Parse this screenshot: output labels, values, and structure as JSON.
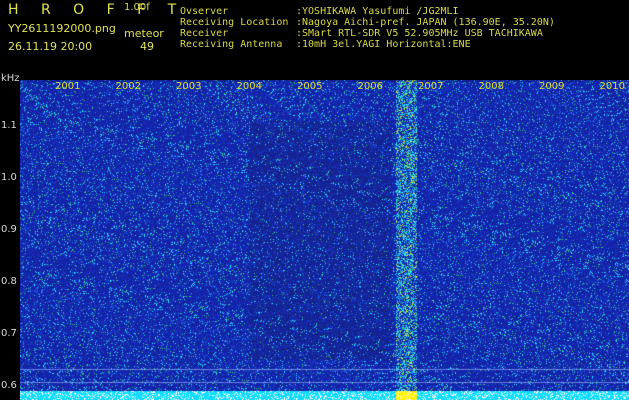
{
  "header": {
    "brand": "H R O F F T",
    "version": "1.00f",
    "filename": "YY2611192000.png",
    "datetime": "26.11.19 20:00",
    "meteor_label": "meteor",
    "meteor_count": "49"
  },
  "info": [
    {
      "key": "Ovserver",
      "value": ":YOSHIKAWA Yasufumi /JG2MLI"
    },
    {
      "key": "Receiving Location",
      "value": ":Nagoya Aichi-pref. JAPAN (136.90E, 35.20N)"
    },
    {
      "key": "Receiver",
      "value": ":SMart RTL-SDR V5 52.905MHz USB TACHIKAWA"
    },
    {
      "key": "Receiving Antenna",
      "value": ":10mH 3el.YAGI Horizontal:ENE"
    }
  ],
  "axis": {
    "unit": "kHz",
    "freq_labels": [
      {
        "text": "1.1",
        "value": 1.1
      },
      {
        "text": "1.0",
        "value": 1.0
      },
      {
        "text": "0.9",
        "value": 0.9
      },
      {
        "text": "0.8",
        "value": 0.8
      },
      {
        "text": "0.7",
        "value": 0.7
      },
      {
        "text": "0.6",
        "value": 0.6
      }
    ],
    "freq_range": [
      0.575,
      1.19
    ],
    "time_labels": [
      "2001",
      "2002",
      "2003",
      "2004",
      "2005",
      "2006",
      "2007",
      "2008",
      "2009",
      "2010"
    ]
  },
  "colors": {
    "text_yellow": "#e0e030",
    "background": "#000000",
    "waterfall_base": "#1e2fa8",
    "noise_bright": "#28e8ff",
    "signal_yellow": "#ffff00"
  }
}
